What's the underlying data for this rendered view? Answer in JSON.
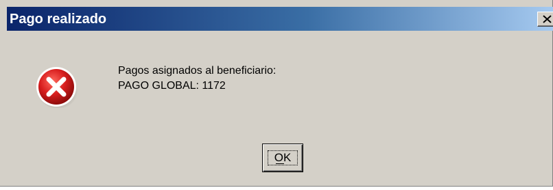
{
  "window": {
    "title": "Pago realizado",
    "close_icon": "close-icon",
    "colors": {
      "title_gradient_start": "#0a246a",
      "title_gradient_end": "#a6caf0",
      "dialog_background": "#d4d0c8",
      "error_red": "#d81e1e"
    }
  },
  "message": {
    "icon": "error-icon",
    "line1": "Pagos asignados al beneficiario:",
    "line2": "PAGO GLOBAL: 1172"
  },
  "buttons": {
    "ok_label": "OK"
  }
}
